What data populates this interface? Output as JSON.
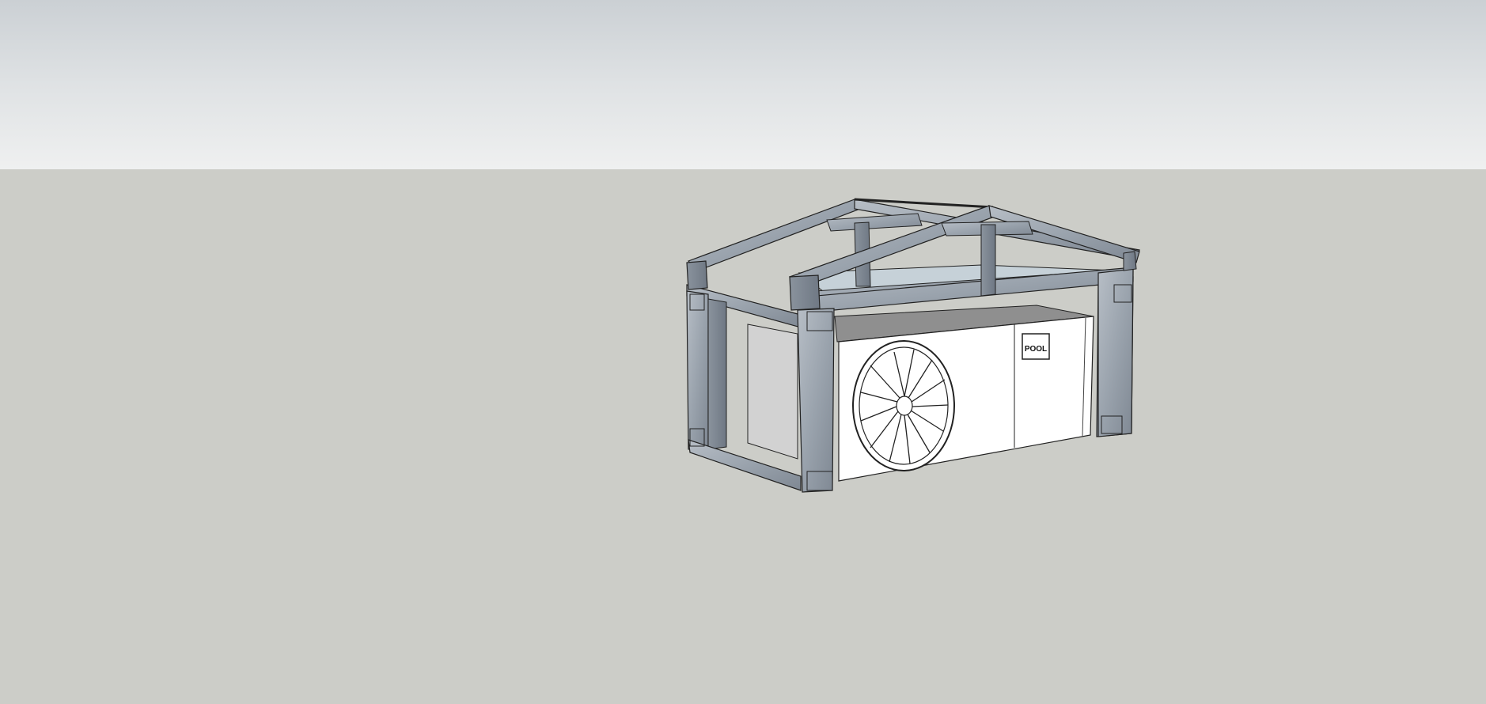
{
  "scene": {
    "sky_colors": [
      "#cbd0d4",
      "#dfe2e4",
      "#eff0f0"
    ],
    "ground_color": "#cccdc8",
    "frame_color": "#9aa3ad",
    "frame_dark": "#6f7884",
    "unit_color": "#ffffff",
    "unit_top_color": "#8f8f8f",
    "glass_color": "#c6d1d8",
    "logo_text": "POOL"
  }
}
